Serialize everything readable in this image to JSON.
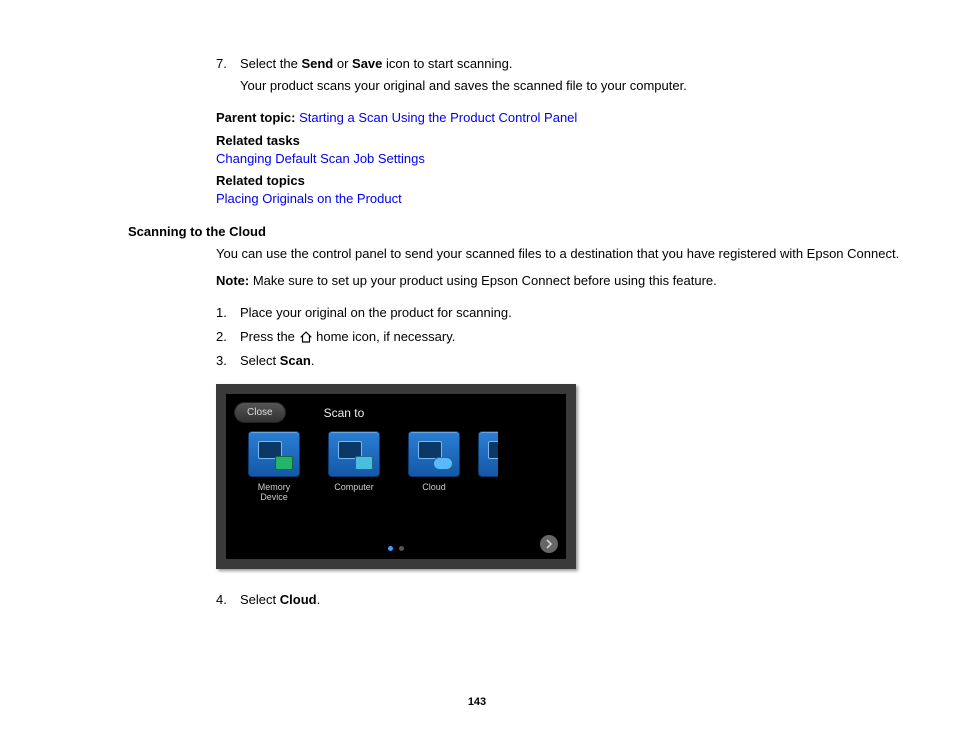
{
  "step7": {
    "num": "7.",
    "pre": "Select the ",
    "b1": "Send",
    "mid": " or ",
    "b2": "Save",
    "post": " icon to start scanning.",
    "sub": "Your product scans your original and saves the scanned file to your computer."
  },
  "parent_topic": {
    "label": "Parent topic:",
    "link": "Starting a Scan Using the Product Control Panel"
  },
  "related_tasks": {
    "label": "Related tasks",
    "link": "Changing Default Scan Job Settings"
  },
  "related_topics": {
    "label": "Related topics",
    "link": "Placing Originals on the Product"
  },
  "section_heading": "Scanning to the Cloud",
  "section_intro": "You can use the control panel to send your scanned files to a destination that you have registered with Epson Connect.",
  "note": {
    "label": "Note:",
    "text": " Make sure to set up your product using Epson Connect before using this feature."
  },
  "steps": {
    "s1": {
      "num": "1.",
      "text": "Place your original on the product for scanning."
    },
    "s2": {
      "num": "2.",
      "pre": "Press the ",
      "post": " home icon, if necessary."
    },
    "s3": {
      "num": "3.",
      "pre": "Select ",
      "b": "Scan",
      "post": "."
    },
    "s4": {
      "num": "4.",
      "pre": "Select ",
      "b": "Cloud",
      "post": "."
    }
  },
  "panel": {
    "close": "Close",
    "title": "Scan to",
    "items": {
      "memory": "Memory\nDevice",
      "computer": "Computer",
      "cloud": "Cloud"
    }
  },
  "page_number": "143"
}
